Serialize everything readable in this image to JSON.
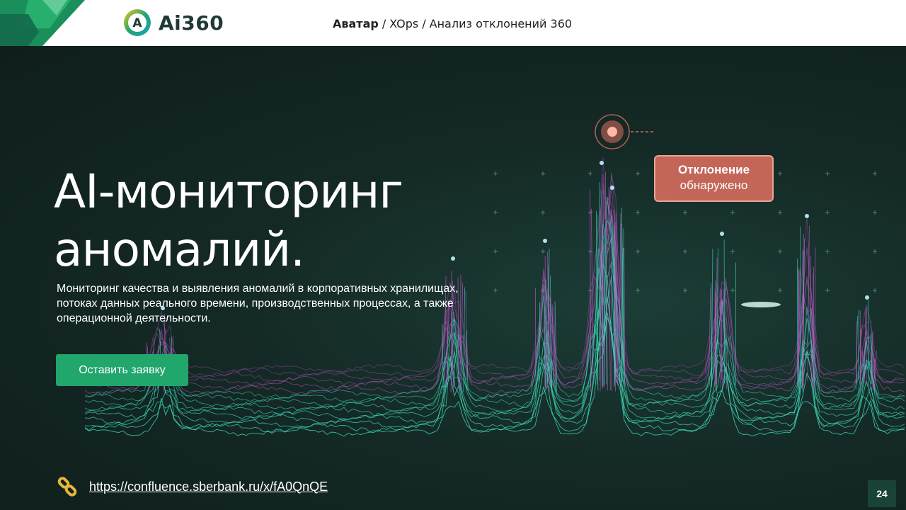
{
  "header": {
    "logo_text": "Ai360",
    "logo_letter": "A",
    "breadcrumb": [
      "Аватар",
      "XOps",
      "Анализ отклонений 360"
    ],
    "breadcrumb_separator": "/"
  },
  "hero": {
    "title_line1": "AI-мониторинг",
    "title_line2": "аномалий.",
    "subtitle": "Мониторинг качества и выявления аномалий в корпоративных хранилищах, потоках данных реального времени, производственных процессах, а также операционной деятельности.",
    "cta_label": "Оставить заявку",
    "callout_title": "Отклонение",
    "callout_text": "обнаружено"
  },
  "footer": {
    "link_text": "https://confluence.sberbank.ru/x/fA0QnQE",
    "link_icon": "link-icon",
    "page_number": "24"
  },
  "colors": {
    "accent_green": "#21a66c",
    "background_dark": "#12221f",
    "spike_magenta": "#d05ad6",
    "wave_cyan": "#3ee0c0",
    "callout_coral": "#dc6e5f"
  }
}
